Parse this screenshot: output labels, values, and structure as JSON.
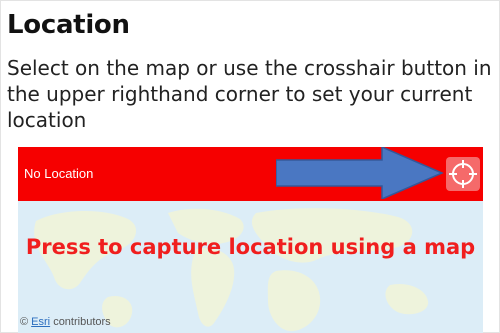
{
  "section": {
    "title": "Location",
    "description": "Select on the map or use the crosshair button in the upper righthand corner to set your current location"
  },
  "map": {
    "status_text": "No Location",
    "capture_prompt": "Press to capture location using a map",
    "attribution_symbol": "©",
    "attribution_link": "Esri",
    "attribution_suffix": "contributors",
    "crosshair_button_icon": "crosshair-icon",
    "arrow_icon": "arrow-right-icon"
  },
  "colors": {
    "bar": "#f60000",
    "crosshair_button": "#f56a6a",
    "capture_text": "#f01e1e",
    "arrow": "#4a77c2",
    "map_water": "#dcedf7"
  }
}
